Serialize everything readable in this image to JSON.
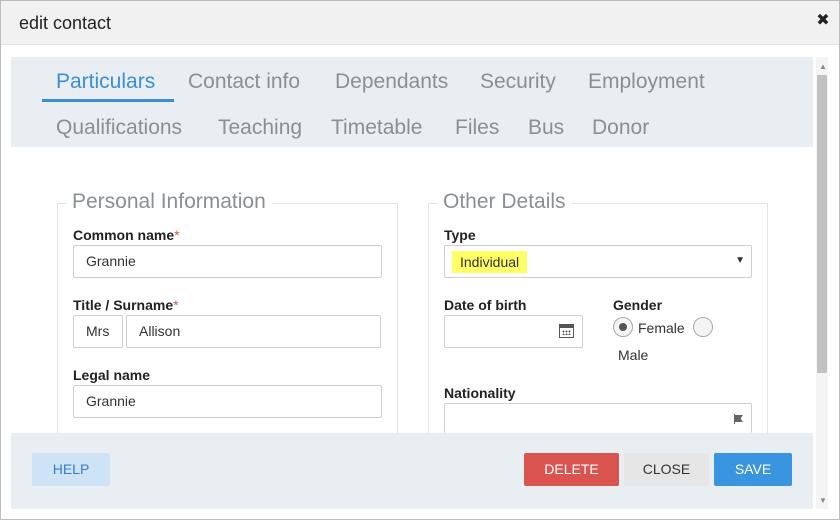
{
  "dialog": {
    "title": "edit contact",
    "close_icon": "close-icon"
  },
  "tabs": [
    {
      "label": "Particulars",
      "active": true
    },
    {
      "label": "Contact info"
    },
    {
      "label": "Dependants"
    },
    {
      "label": "Security"
    },
    {
      "label": "Employment"
    },
    {
      "label": "Qualifications"
    },
    {
      "label": "Teaching"
    },
    {
      "label": "Timetable"
    },
    {
      "label": "Files"
    },
    {
      "label": "Bus"
    },
    {
      "label": "Donor"
    }
  ],
  "personal": {
    "legend": "Personal Information",
    "common_name": {
      "label": "Common name",
      "required": "*",
      "value": "Grannie"
    },
    "title_surname": {
      "label": "Title / Surname",
      "required": "*",
      "title_value": "Mrs",
      "surname_value": "Allison"
    },
    "legal_name": {
      "label": "Legal name",
      "value": "Grannie"
    }
  },
  "other": {
    "legend": "Other Details",
    "type": {
      "label": "Type",
      "value": "Individual"
    },
    "dob": {
      "label": "Date of birth",
      "value": ""
    },
    "gender": {
      "label": "Gender",
      "options": [
        "Female",
        "Male"
      ],
      "selected": "Female"
    },
    "nationality": {
      "label": "Nationality",
      "value": ""
    }
  },
  "footer": {
    "help": "HELP",
    "delete": "DELETE",
    "close": "CLOSE",
    "save": "SAVE"
  },
  "colors": {
    "accent": "#3a8fd6",
    "danger": "#d9534f",
    "primary": "#3a95e0",
    "highlight": "#ffff66"
  },
  "icons": [
    "close-icon",
    "calendar-icon",
    "flag-icon",
    "chevron-down-icon"
  ]
}
